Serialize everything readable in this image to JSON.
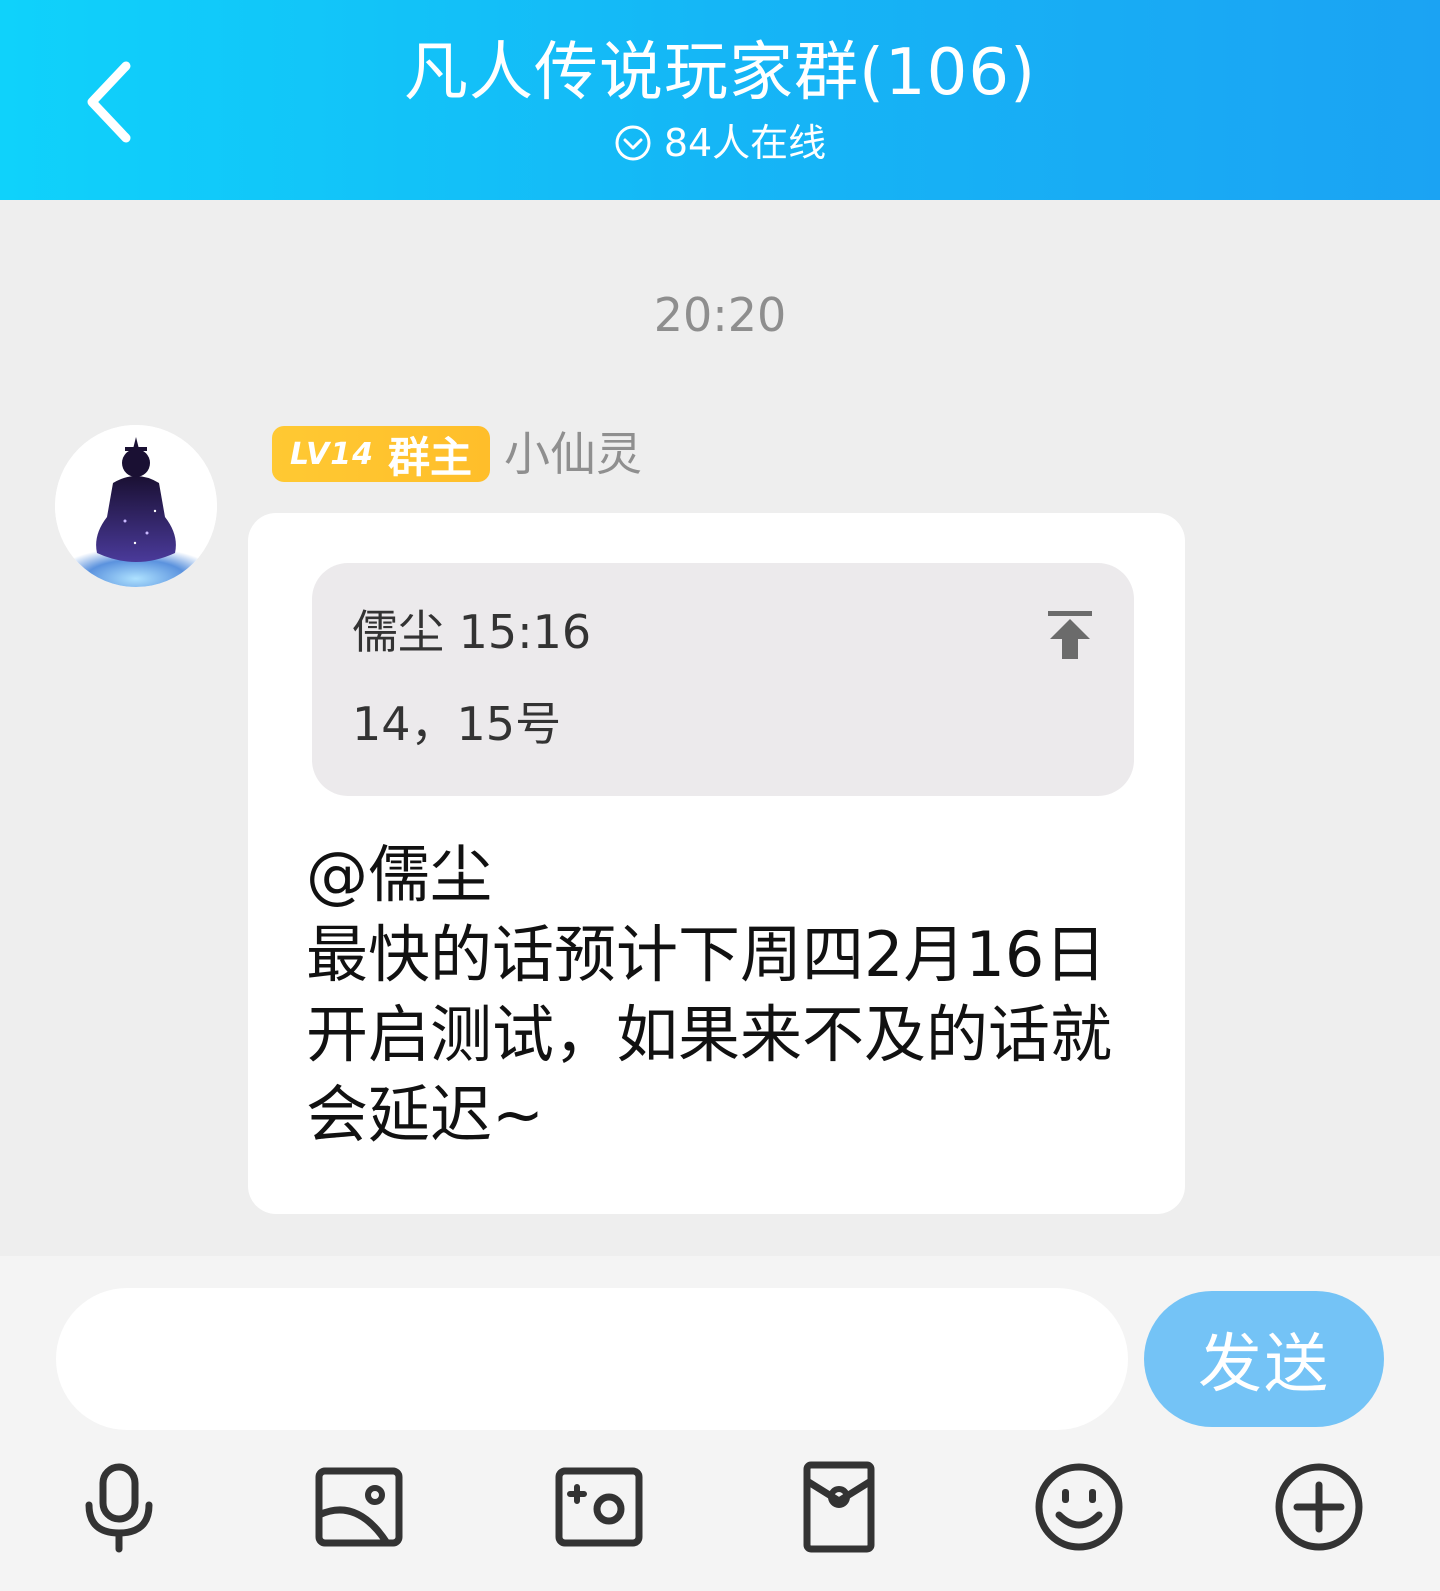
{
  "header": {
    "title": "凡人传说玩家群(106)",
    "online_text": "84人在线",
    "icons": {
      "back": "back-arrow-icon",
      "online": "online-check-icon"
    }
  },
  "chat": {
    "timestamp": "20:20",
    "message": {
      "sender_badge_level": "LV14",
      "sender_badge_role": "群主",
      "sender_name": "小仙灵",
      "quote": {
        "author_time": "儒尘 15:16",
        "text": "14，15号",
        "icon": "pin-to-top-icon"
      },
      "mention": "@儒尘",
      "text": "最快的话预计下周四2月16日开启测试，如果来不及的话就会延迟~"
    }
  },
  "input": {
    "value": "",
    "send_label": "发送"
  },
  "toolbar": [
    "microphone-icon",
    "image-icon",
    "camera-icon",
    "red-packet-icon",
    "emoji-icon",
    "plus-icon"
  ],
  "colors": {
    "header_start": "#0fd2fb",
    "header_end": "#1ba3f3",
    "badge": "#ffc933",
    "send_button": "#74c3f6",
    "background": "#eeeeee"
  }
}
